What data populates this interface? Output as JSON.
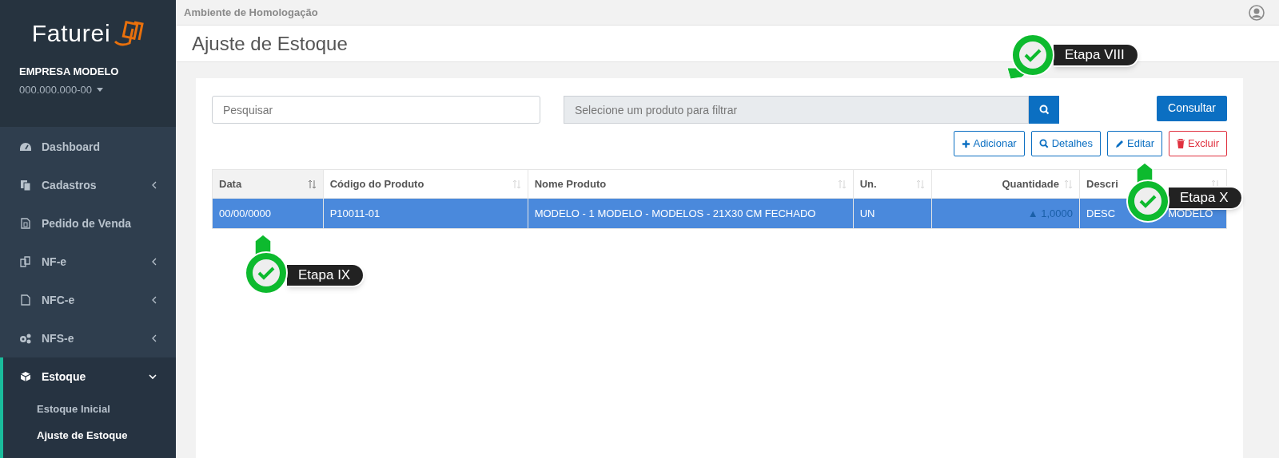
{
  "sidebar": {
    "logo": "Faturei",
    "company": {
      "name": "EMPRESA MODELO",
      "document": "000.000.000-00"
    },
    "items": [
      {
        "label": "Dashboard",
        "kind": "link",
        "selected": false
      },
      {
        "label": "Cadastros",
        "kind": "group",
        "expanded": false,
        "selected": false
      },
      {
        "label": "Pedido de Venda",
        "kind": "link",
        "selected": false
      },
      {
        "label": "NF-e",
        "kind": "group",
        "expanded": false,
        "selected": false
      },
      {
        "label": "NFC-e",
        "kind": "group",
        "expanded": false,
        "selected": false
      },
      {
        "label": "NFS-e",
        "kind": "group",
        "expanded": false,
        "selected": false
      },
      {
        "label": "Estoque",
        "kind": "group",
        "expanded": true,
        "selected": true,
        "children": [
          {
            "label": "Estoque Inicial",
            "selected": false
          },
          {
            "label": "Ajuste de Estoque",
            "selected": true
          }
        ]
      }
    ]
  },
  "top_bar": {
    "environment": "Ambiente de Homologação"
  },
  "page": {
    "title": "Ajuste de Estoque"
  },
  "filters": {
    "search": {
      "placeholder": "Pesquisar"
    },
    "product": {
      "placeholder": "Selecione um produto para filtrar"
    },
    "submit": "Consultar"
  },
  "actions": [
    {
      "label": "Adicionar",
      "kind": "add"
    },
    {
      "label": "Detalhes",
      "kind": "details"
    },
    {
      "label": "Editar",
      "kind": "edit"
    },
    {
      "label": "Excluir",
      "kind": "delete"
    }
  ],
  "table": {
    "columns": [
      {
        "label": "Data",
        "sorted": true
      },
      {
        "label": "Código do Produto",
        "sorted": false
      },
      {
        "label": "Nome Produto",
        "sorted": false
      },
      {
        "label": "Un.",
        "sorted": false
      },
      {
        "label": "Quantidade",
        "sorted": false
      },
      {
        "label": "Descri",
        "sorted": false
      }
    ],
    "rows": [
      {
        "selected": true,
        "cells": [
          "00/00/0000",
          "P10011-01",
          "MODELO - 1 MODELO - MODELOS - 21X30 CM FECHADO",
          "UN",
          "▲ 1,0000",
          [
            "DESC",
            "MODELO"
          ]
        ]
      }
    ]
  },
  "callouts": [
    {
      "label": "Etapa VIII"
    },
    {
      "label": "Etapa IX"
    },
    {
      "label": "Etapa X"
    }
  ]
}
